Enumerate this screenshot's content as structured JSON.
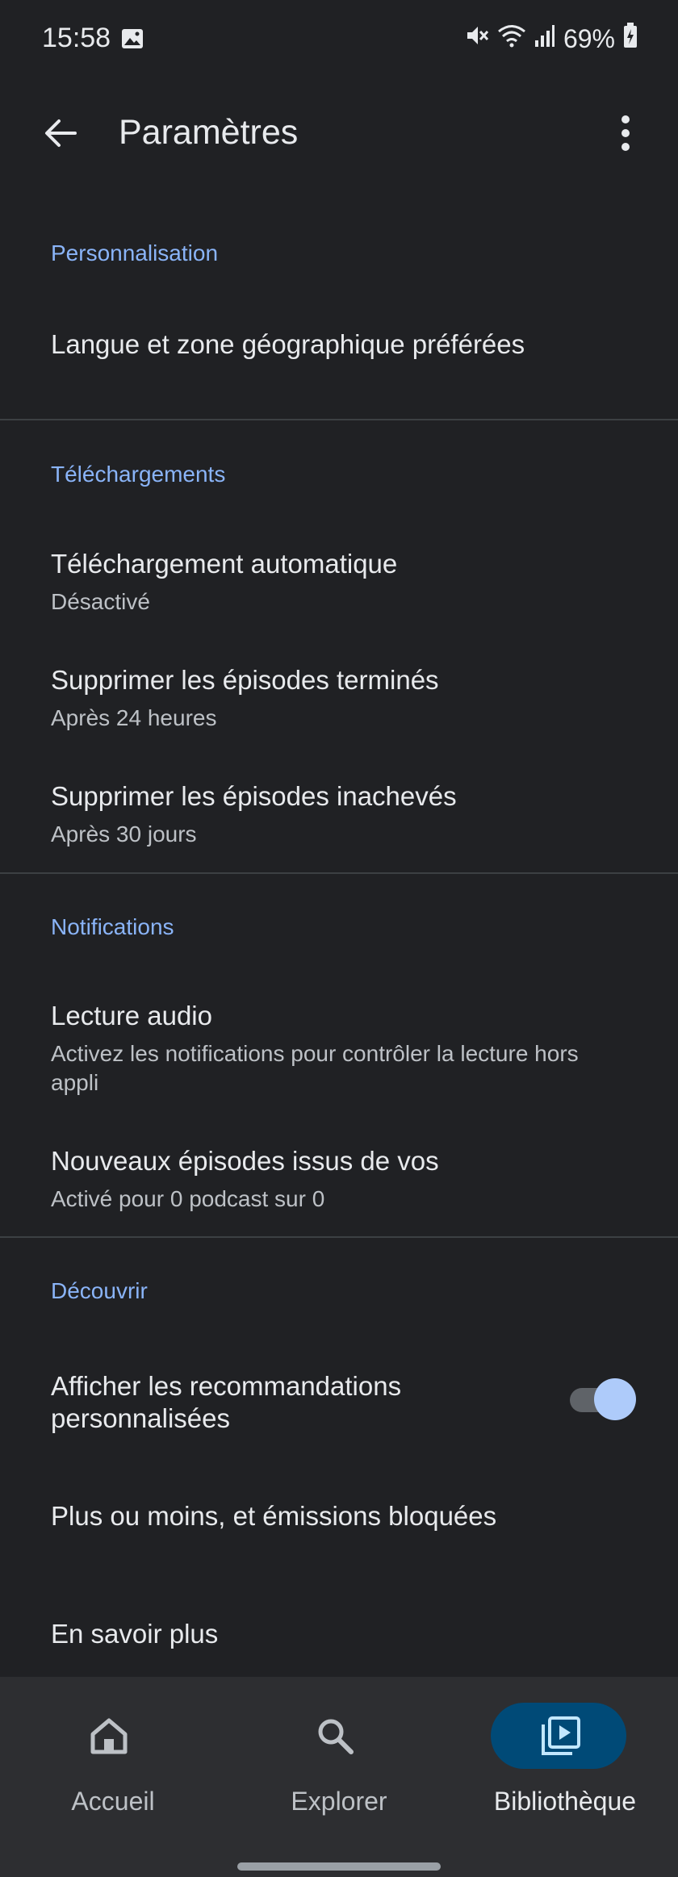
{
  "status_bar": {
    "time": "15:58",
    "battery": "69%"
  },
  "app_bar": {
    "title": "Paramètres"
  },
  "sections": {
    "personalization": {
      "header": "Personnalisation",
      "language_title": "Langue et zone géographique préférées"
    },
    "downloads": {
      "header": "Téléchargements",
      "auto_title": "Téléchargement automatique",
      "auto_sub": "Désactivé",
      "finished_title": "Supprimer les épisodes terminés",
      "finished_sub": "Après 24 heures",
      "unfinished_title": "Supprimer les épisodes inachevés",
      "unfinished_sub": "Après 30 jours"
    },
    "notifications": {
      "header": "Notifications",
      "playback_title": "Lecture audio",
      "playback_sub": "Activez les notifications pour contrôler la lecture hors appli",
      "new_eps_title": "Nouveaux épisodes issus de vos",
      "new_eps_sub": "Activé pour 0 podcast sur 0"
    },
    "discover": {
      "header": "Découvrir",
      "reco_title": "Afficher les recommandations personnalisées",
      "reco_enabled": true,
      "more_less_title": "Plus ou moins, et émissions bloquées",
      "learn_more_title": "En savoir plus"
    }
  },
  "bottom_nav": {
    "items": [
      {
        "label": "Accueil",
        "icon": "home-icon",
        "active": false
      },
      {
        "label": "Explorer",
        "icon": "search-icon",
        "active": false
      },
      {
        "label": "Bibliothèque",
        "icon": "library-icon",
        "active": true
      }
    ]
  },
  "colors": {
    "background": "#202124",
    "accent": "#8ab4f8",
    "nav_active": "#004a77",
    "toggle_thumb": "#aecbfa"
  }
}
